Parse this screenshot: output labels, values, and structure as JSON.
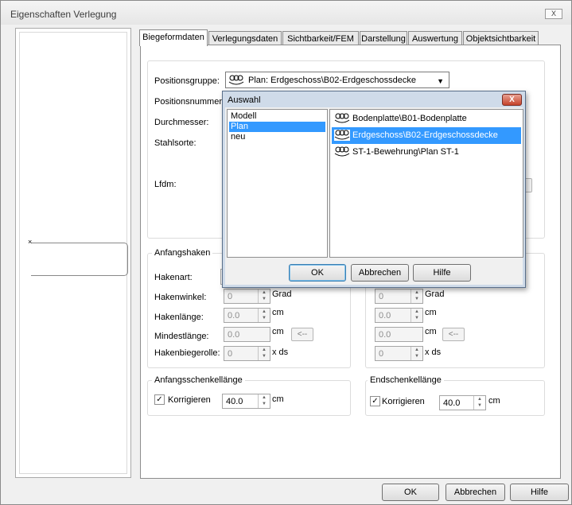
{
  "window": {
    "title": "Eigenschaften Verlegung",
    "close_label": "X"
  },
  "tabs": [
    "Biegeformdaten",
    "Verlegungsdaten",
    "Sichtbarkeit/FEM",
    "Darstellung",
    "Auswertung",
    "Objektsichtbarkeit"
  ],
  "form": {
    "positionsgruppe_label": "Positionsgruppe:",
    "positionsgruppe_value": "Plan: Erdgeschoss\\B02-Erdgeschossdecke",
    "positionsnummer_label": "Positionsnummer:",
    "durchmesser_label": "Durchmesser:",
    "stahlsorte_label": "Stahlsorte:",
    "lfdm_label": "Lfdm:"
  },
  "anfangshaken": {
    "title": "Anfangshaken",
    "hakenart_label": "Hakenart:",
    "hakenwinkel_label": "Hakenwinkel:",
    "hakenwinkel_value": "0",
    "hakenwinkel_unit": "Grad",
    "hakenlaenge_label": "Hakenlänge:",
    "hakenlaenge_value": "0.0",
    "hakenlaenge_unit": "cm",
    "mindestlaenge_label": "Mindestlänge:",
    "mindestlaenge_value": "0.0",
    "mindestlaenge_unit": "cm",
    "mindestlaenge_btn": "<--",
    "hakenbiegerolle_label": "Hakenbiegerolle:",
    "hakenbiegerolle_value": "0",
    "hakenbiegerolle_unit": "x ds"
  },
  "endhaken": {
    "hakenwinkel_value": "0",
    "hakenwinkel_unit": "Grad",
    "hakenlaenge_value": "0.0",
    "hakenlaenge_unit": "cm",
    "mindestlaenge_value": "0.0",
    "mindestlaenge_unit": "cm",
    "mindestlaenge_btn": "<--",
    "hakenbiegerolle_value": "0",
    "hakenbiegerolle_unit": "x ds"
  },
  "anfangsschenkel": {
    "title": "Anfangsschenkellänge",
    "check_label": "Korrigieren",
    "checked": true,
    "value": "40.0",
    "unit": "cm"
  },
  "endschenkel": {
    "title": "Endschenkellänge",
    "check_label": "Korrigieren",
    "checked": true,
    "value": "40.0",
    "unit": "cm"
  },
  "buttons": {
    "ok": "OK",
    "cancel": "Abbrechen",
    "help": "Hilfe"
  },
  "dialog": {
    "title": "Auswahl",
    "close_label": "X",
    "left_items": [
      "Modell",
      "Plan",
      "neu"
    ],
    "left_selected": "Plan",
    "right_items": [
      "Bodenplatte\\B01-Bodenplatte",
      "Erdgeschoss\\B02-Erdgeschossdecke",
      "ST-1-Bewehrung\\Plan ST-1"
    ],
    "right_selected": "Erdgeschoss\\B02-Erdgeschossdecke",
    "right_icon": "group-icon",
    "ok": "OK",
    "cancel": "Abbrechen",
    "help": "Hilfe"
  },
  "colors": {
    "selection": "#3399ff",
    "dialog_frame": "#cfdbe9",
    "close_red": "#c5422a"
  }
}
